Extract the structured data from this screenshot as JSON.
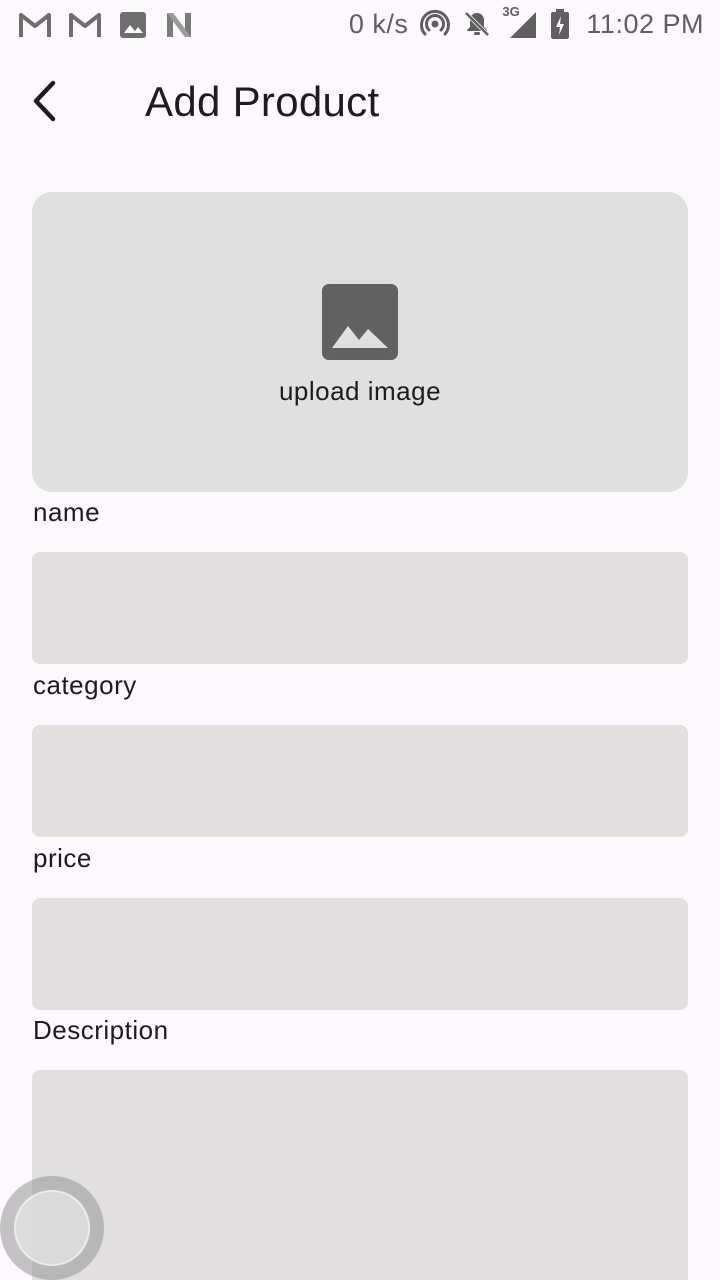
{
  "status_bar": {
    "left_icons": [
      "gmail-icon",
      "gmail-icon",
      "image-icon",
      "n-logo-icon"
    ],
    "net_speed": "0 k/s",
    "right_icons": [
      "hotspot-icon",
      "mute-bell-icon",
      "signal-3g-icon",
      "battery-charging-icon"
    ],
    "network_type": "3G",
    "time": "11:02 PM"
  },
  "app_bar": {
    "back_icon": "chevron-left-icon",
    "title": "Add Product"
  },
  "upload": {
    "icon": "image-icon",
    "label": "upload image"
  },
  "form": {
    "fields": [
      {
        "label": "name",
        "value": ""
      },
      {
        "label": "category",
        "value": ""
      },
      {
        "label": "price",
        "value": ""
      },
      {
        "label": "Description",
        "value": ""
      }
    ]
  },
  "colors": {
    "background": "#fdf7fe",
    "upload_box": "#e0e0e0",
    "input_fill": "#e3dfdf",
    "text": "#1d1b20",
    "icon_gray": "#616161"
  }
}
